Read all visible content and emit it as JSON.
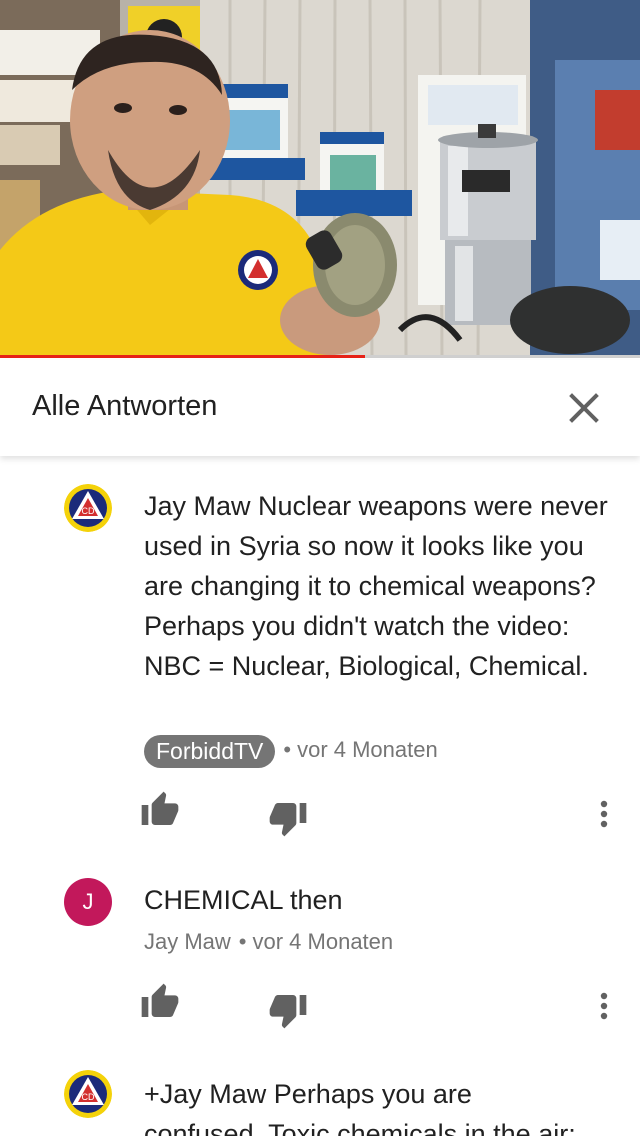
{
  "video": {
    "progress_fraction": 0.57
  },
  "replies_header": {
    "title": "Alle Antworten"
  },
  "comments": [
    {
      "avatar": "civil-defense-logo",
      "text": "Jay Maw  Nuclear weapons were never used in Syria so now it looks like you are changing it to chemical weapons?   Perhaps you didn't watch the video:  NBC = Nuclear, Biological, Chemical.",
      "author": "ForbiddTV",
      "author_style": "chip",
      "separator": "•",
      "time": "vor 4 Monaten"
    },
    {
      "avatar_letter": "J",
      "avatar_color": "#c2185b",
      "text": "CHEMICAL then",
      "author": "Jay Maw",
      "separator": "•",
      "time": "vor 4 Monaten"
    },
    {
      "avatar": "civil-defense-logo",
      "text_line1": "+Jay Maw  Perhaps you are",
      "text_line2": "confused.  Toxic chemicals in the air;"
    }
  ],
  "colors": {
    "progress": "#e62117",
    "chip": "#757575",
    "avatar_j": "#c2185b",
    "logo_ring": "#f4d20a",
    "logo_navy": "#1b2a7a",
    "logo_red": "#d32f2f"
  },
  "icons": {
    "close": "close-icon",
    "like": "thumb-up-icon",
    "dislike": "thumb-down-icon",
    "more": "more-vert-icon"
  }
}
